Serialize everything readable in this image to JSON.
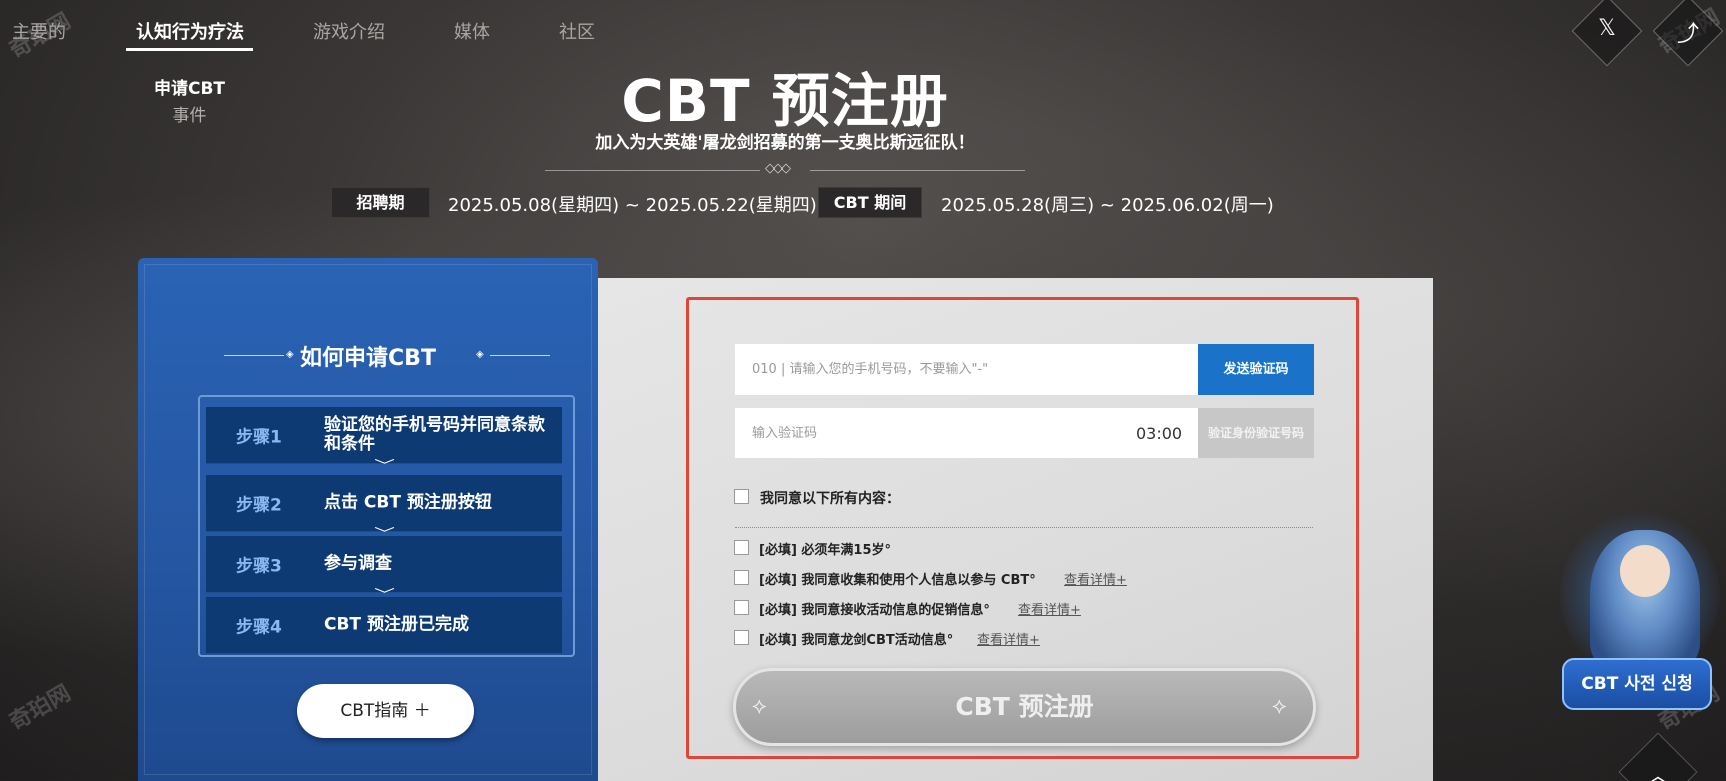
{
  "nav": {
    "items": [
      {
        "label": "主要的"
      },
      {
        "label": "认知行为疗法"
      },
      {
        "label": "游戏介绍"
      },
      {
        "label": "媒体"
      },
      {
        "label": "社区"
      }
    ],
    "sub_items": [
      {
        "label": "申请CBT"
      },
      {
        "label": "事件"
      }
    ]
  },
  "social": {
    "x_icon": "x-icon",
    "x_glyph": "𝕏",
    "share_icon": "share-icon",
    "share_glyph": "⤴"
  },
  "header": {
    "title": "CBT 预注册",
    "subtitle": "加入为大英雄'屠龙剑招募的第一支奥比斯远征队！",
    "divider_mark": "◇◇◇",
    "recruit_label": "招聘期",
    "recruit_period": "2025.05.08(星期四) ~ 2025.05.22(星期四)",
    "cbt_label": "CBT 期间",
    "cbt_period": "2025.05.28(周三) ~ 2025.06.02(周一)"
  },
  "how_to": {
    "title": "如何申请CBT",
    "steps": [
      {
        "num": "步骤1",
        "text": "验证您的手机号码并同意条款和条件"
      },
      {
        "num": "步骤2",
        "text": "点击 CBT 预注册按钮"
      },
      {
        "num": "步骤3",
        "text": "参与调查"
      },
      {
        "num": "步骤4",
        "text": "CBT 预注册已完成"
      }
    ],
    "chevron": "﹀",
    "guide_label": "CBT指南 ＋"
  },
  "form": {
    "phone_placeholder": "010 | 请输入您的手机号码，不要输入\"-\"",
    "send_code_label": "发送验证码",
    "code_placeholder": "输入验证码",
    "timer": "03:00",
    "verify_label": "验证身份验证号码",
    "agree_all_label": "我同意以下所有内容：",
    "agreements": [
      {
        "label": "[必填] 必须年满15岁°",
        "details": ""
      },
      {
        "label": "[必填] 我同意收集和使用个人信息以参与 CBT°",
        "details": "查看详情+"
      },
      {
        "label": "[必填] 我同意接收活动信息的促销信息°",
        "details": "查看详情+"
      },
      {
        "label": "[必填] 我同意龙剑CBT活动信息°",
        "details": "查看详情+"
      }
    ],
    "register_label": "CBT 预注册",
    "register_deco": "⟡"
  },
  "side": {
    "pre_register_label": "CBT 사전 신청",
    "top_icon": "chevron-up-icon",
    "top_glyph": "︿"
  },
  "watermark": "奇珀网",
  "colors": {
    "accent_blue": "#1a73c9",
    "panel_blue": "#2557a3",
    "step_blue": "#0e3a73",
    "highlight_red": "#e0453a"
  }
}
